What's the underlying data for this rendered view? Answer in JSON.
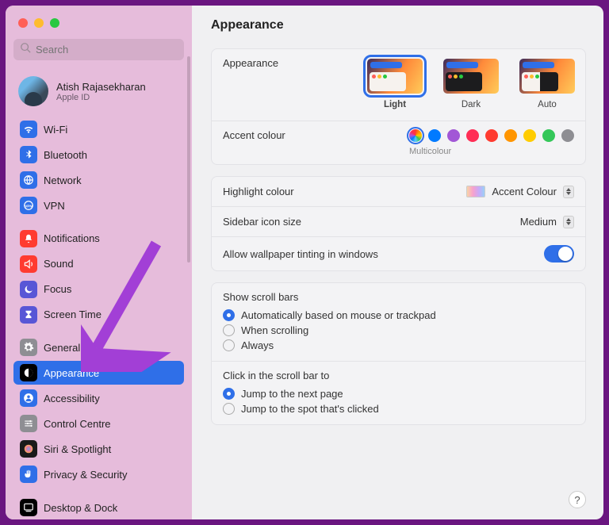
{
  "window_title": "Appearance",
  "search": {
    "placeholder": "Search"
  },
  "user": {
    "name": "Atish Rajasekharan",
    "sub": "Apple ID"
  },
  "sidebar": {
    "items": [
      {
        "label": "Wi-Fi",
        "icon": "wifi",
        "bg": "#2f6fe8"
      },
      {
        "label": "Bluetooth",
        "icon": "bluetooth",
        "bg": "#2f6fe8"
      },
      {
        "label": "Network",
        "icon": "globe",
        "bg": "#2f6fe8"
      },
      {
        "label": "VPN",
        "icon": "vpn",
        "bg": "#2f6fe8"
      },
      {
        "label": "Notifications",
        "icon": "bell",
        "bg": "#ff3b30"
      },
      {
        "label": "Sound",
        "icon": "speaker",
        "bg": "#ff3b30"
      },
      {
        "label": "Focus",
        "icon": "moon",
        "bg": "#5856d6"
      },
      {
        "label": "Screen Time",
        "icon": "hourglass",
        "bg": "#5856d6"
      },
      {
        "label": "General",
        "icon": "gear",
        "bg": "#8e8e93"
      },
      {
        "label": "Appearance",
        "icon": "contrast",
        "bg": "#000000",
        "selected": true
      },
      {
        "label": "Accessibility",
        "icon": "person",
        "bg": "#2f6fe8"
      },
      {
        "label": "Control Centre",
        "icon": "sliders",
        "bg": "#8e8e93"
      },
      {
        "label": "Siri & Spotlight",
        "icon": "siri",
        "bg": "#1a1a1a"
      },
      {
        "label": "Privacy & Security",
        "icon": "hand",
        "bg": "#2f6fe8"
      },
      {
        "label": "Desktop & Dock",
        "icon": "dock",
        "bg": "#000000"
      }
    ]
  },
  "appearance_section": {
    "label": "Appearance",
    "options": [
      {
        "label": "Light",
        "selected": true
      },
      {
        "label": "Dark",
        "selected": false
      },
      {
        "label": "Auto",
        "selected": false
      }
    ]
  },
  "accent": {
    "label": "Accent colour",
    "sub": "Multicolour",
    "colors": [
      "multi",
      "#007aff",
      "#a257d6",
      "#ff2d55",
      "#ff3b30",
      "#ff9500",
      "#ffcc00",
      "#34c759",
      "#8e8e93"
    ],
    "selected_index": 0
  },
  "highlight": {
    "label": "Highlight colour",
    "value": "Accent Colour"
  },
  "icon_size": {
    "label": "Sidebar icon size",
    "value": "Medium"
  },
  "tinting": {
    "label": "Allow wallpaper tinting in windows",
    "on": true
  },
  "scrollbars": {
    "label": "Show scroll bars",
    "options": [
      "Automatically based on mouse or trackpad",
      "When scrolling",
      "Always"
    ],
    "selected": 0
  },
  "scrollclick": {
    "label": "Click in the scroll bar to",
    "options": [
      "Jump to the next page",
      "Jump to the spot that's clicked"
    ],
    "selected": 0
  },
  "help": "?"
}
